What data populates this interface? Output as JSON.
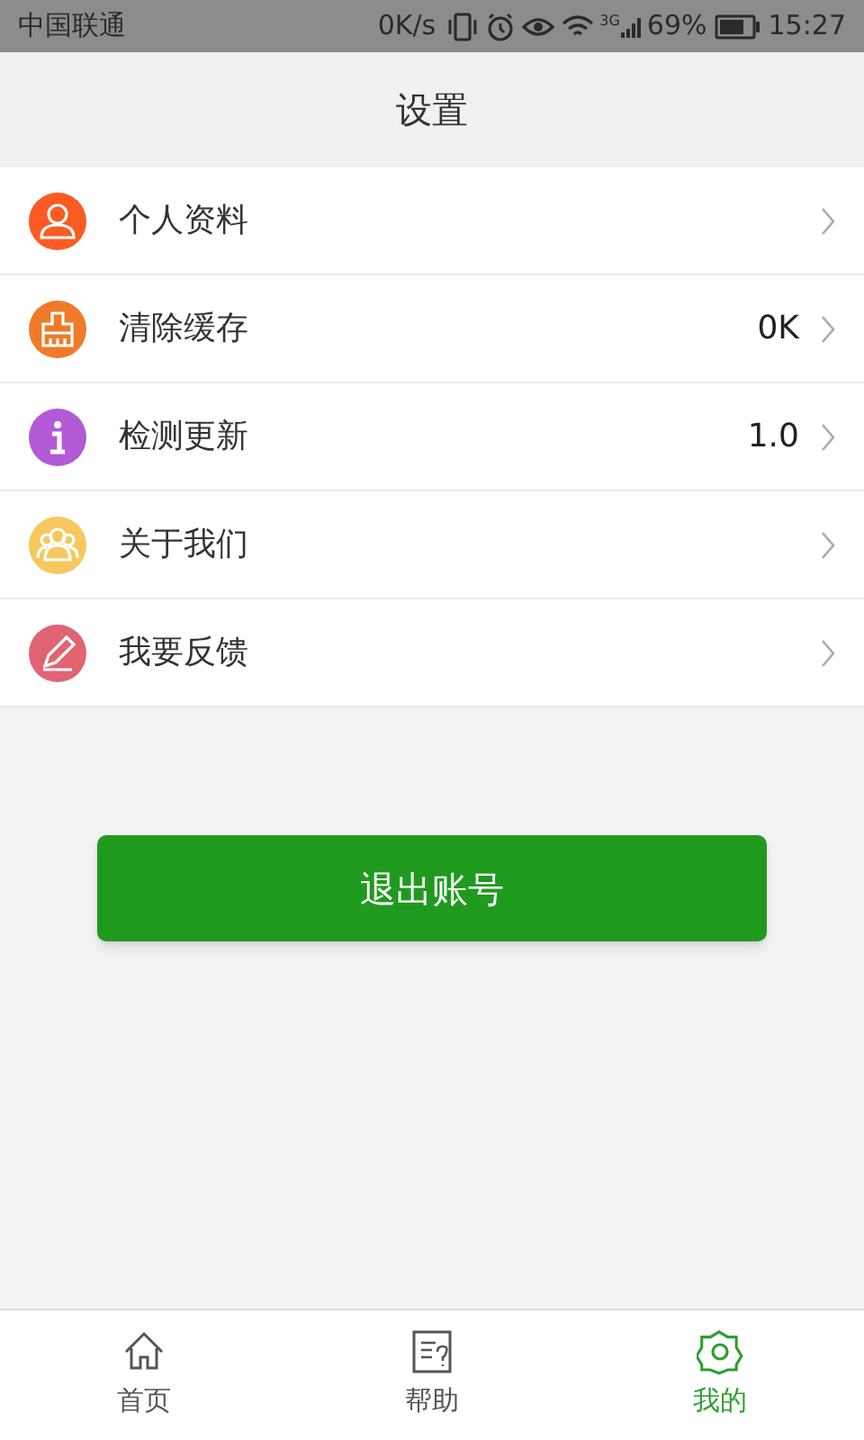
{
  "status_bar": {
    "carrier": "中国联通",
    "speed": "0K/s",
    "network": "3G",
    "battery": "69%",
    "time": "15:27"
  },
  "header": {
    "title": "设置"
  },
  "settings": [
    {
      "kind": "person",
      "color": "#fb5b22",
      "label": "个人资料"
    },
    {
      "kind": "broom",
      "color": "#f07a2a",
      "label": "清除缓存",
      "value": "0K"
    },
    {
      "kind": "info",
      "color": "#b35ad6",
      "label": "检测更新",
      "value": "1.0"
    },
    {
      "kind": "group",
      "color": "#f6c85d",
      "label": "关于我们"
    },
    {
      "kind": "pencil",
      "color": "#e06472",
      "label": "我要反馈"
    }
  ],
  "logout_button": "退出账号",
  "tabs": [
    {
      "kind": "home",
      "label": "首页",
      "selected": false
    },
    {
      "kind": "help",
      "label": "帮助",
      "selected": false
    },
    {
      "kind": "gear",
      "label": "我的",
      "selected": true
    }
  ]
}
